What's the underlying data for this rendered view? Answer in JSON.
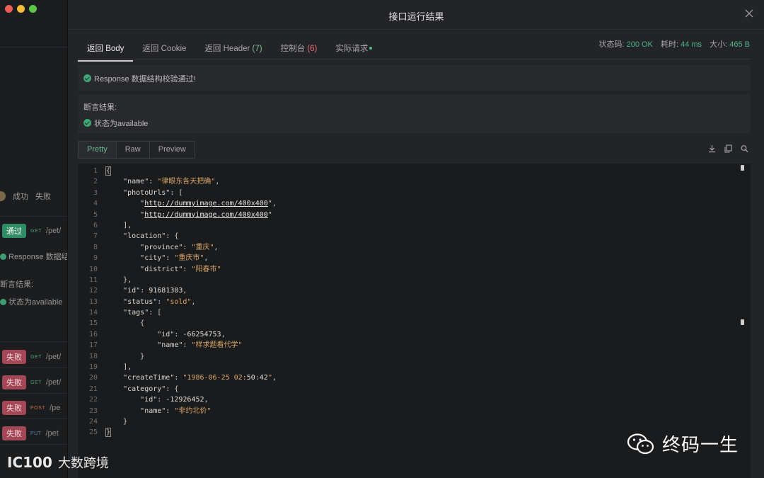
{
  "background_app": {
    "filter": {
      "success": "成功",
      "failure": "失败"
    },
    "rows": [
      {
        "badge": "通过",
        "status": "pass",
        "method": "GET",
        "path": "/pet/"
      },
      {
        "badge": "失败",
        "status": "fail",
        "method": "GET",
        "path": "/pet/"
      },
      {
        "badge": "失败",
        "status": "fail",
        "method": "GET",
        "path": "/pet/"
      },
      {
        "badge": "失败",
        "status": "fail",
        "method": "POST",
        "path": "/pe"
      },
      {
        "badge": "失败",
        "status": "fail",
        "method": "PUT",
        "path": "/pet"
      }
    ],
    "response_text": "Response 数据结构",
    "assert_label": "断言结果:",
    "assert_item": "状态为available"
  },
  "modal": {
    "title": "接口运行结果",
    "tabs": [
      {
        "label": "返回 Body",
        "count": ""
      },
      {
        "label": "返回 Cookie",
        "count": ""
      },
      {
        "label": "返回 Header",
        "count": "(7)"
      },
      {
        "label": "控制台",
        "count": "(6)"
      },
      {
        "label": "实际请求",
        "count": ""
      }
    ],
    "stats": {
      "status_label": "状态码:",
      "status_value": "200 OK",
      "time_label": "耗时:",
      "time_value": "44 ms",
      "size_label": "大小:",
      "size_value": "465 B"
    },
    "validation_message": "Response 数据结构校验通过!",
    "assertion_title": "断言结果:",
    "assertion_item": "状态为available",
    "view_tabs": [
      "Pretty",
      "Raw",
      "Preview"
    ],
    "icons": [
      "download-icon",
      "copy-icon",
      "search-icon"
    ]
  },
  "code": {
    "line_numbers": [
      "1",
      "2",
      "3",
      "4",
      "5",
      "6",
      "7",
      "8",
      "9",
      "10",
      "11",
      "12",
      "13",
      "14",
      "15",
      "16",
      "17",
      "18",
      "19",
      "20",
      "21",
      "22",
      "23",
      "24",
      "25"
    ],
    "lines": [
      "{",
      "    \"name\": \"律眼东各天把确\",",
      "    \"photoUrls\": [",
      "        \"http://dummyimage.com/400x400\",",
      "        \"http://dummyimage.com/400x400\"",
      "    ],",
      "    \"location\": {",
      "        \"province\": \"重庆\",",
      "        \"city\": \"重庆市\",",
      "        \"district\": \"阳春市\"",
      "    },",
      "    \"id\": 91681303,",
      "    \"status\": \"sold\",",
      "    \"tags\": [",
      "        {",
      "            \"id\": -66254753,",
      "            \"name\": \"样求题看代学\"",
      "        }",
      "    ],",
      "    \"createTime\": \"1986-06-25 02:50:42\",",
      "    \"category\": {",
      "        \"id\": -12926452,",
      "        \"name\": \"非约北价\"",
      "    }",
      "}"
    ]
  },
  "watermark": {
    "right": "终码一生",
    "left_mark": "IC100",
    "left_text": "大数跨境"
  }
}
